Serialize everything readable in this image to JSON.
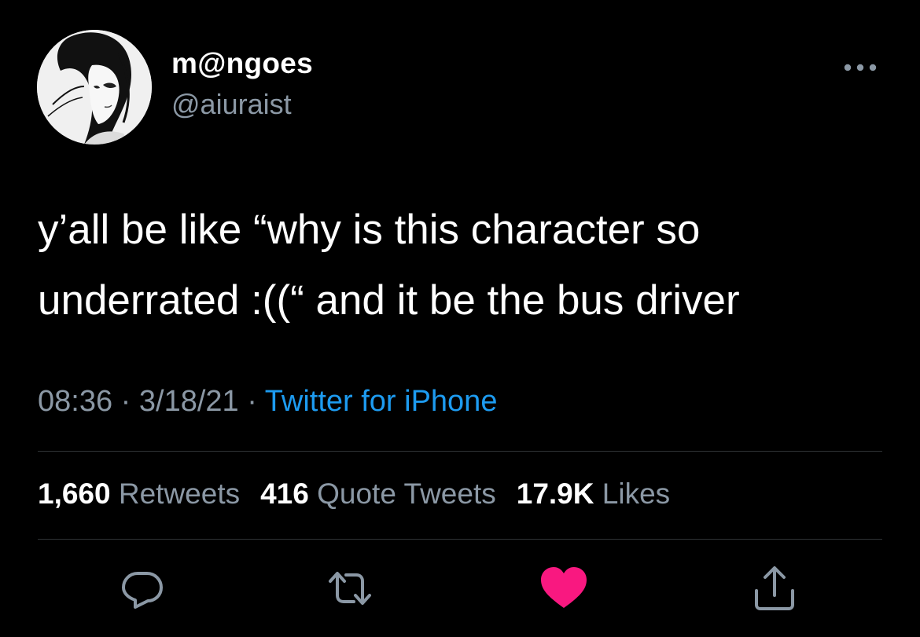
{
  "author": {
    "display_name": "m@ngoes",
    "handle": "@aiuraist",
    "avatar_icon": "anime-girl-avatar"
  },
  "more_icon": "ellipsis-icon",
  "tweet": {
    "lines": [
      "y’all be like “why is this character so",
      "underrated :((“ and it be the bus driver"
    ]
  },
  "meta": {
    "time": "08:36",
    "separator": "·",
    "date": "3/18/21",
    "source": "Twitter for iPhone"
  },
  "stats": {
    "retweets_count": "1,660",
    "retweets_label": "Retweets",
    "quotes_count": "416",
    "quotes_label": "Quote Tweets",
    "likes_count": "17.9K",
    "likes_label": "Likes"
  },
  "actions": {
    "reply_icon": "reply-icon",
    "retweet_icon": "retweet-icon",
    "like_icon": "heart-icon",
    "share_icon": "share-icon",
    "liked": true
  },
  "colors": {
    "background": "#000000",
    "text": "#ffffff",
    "secondary": "#8b98a5",
    "link": "#1d9bf0",
    "like": "#f91880",
    "divider": "#2f3336"
  }
}
